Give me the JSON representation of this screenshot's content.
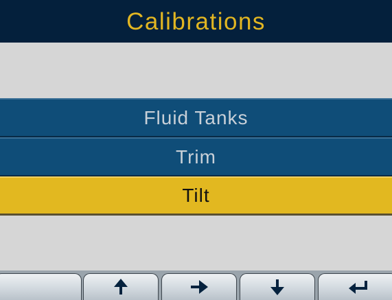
{
  "header": {
    "title": "Calibrations"
  },
  "menu": {
    "items": [
      {
        "label": "Fluid Tanks",
        "selected": false
      },
      {
        "label": "Trim",
        "selected": false
      },
      {
        "label": "Tilt",
        "selected": true
      }
    ]
  },
  "softkeys": [
    {
      "icon": "blank",
      "label": ""
    },
    {
      "icon": "arrow-up-icon",
      "label": ""
    },
    {
      "icon": "arrow-right-icon",
      "label": ""
    },
    {
      "icon": "arrow-down-icon",
      "label": ""
    },
    {
      "icon": "return-arrow-icon",
      "label": ""
    }
  ],
  "colors": {
    "title_bar": "#04203c",
    "title_text": "#e2b622",
    "menu_item": "#0f4d78",
    "menu_item_text": "#c8d0d8",
    "selected_item": "#e2b820",
    "selected_text": "#111111",
    "background": "#d6d6d6"
  }
}
